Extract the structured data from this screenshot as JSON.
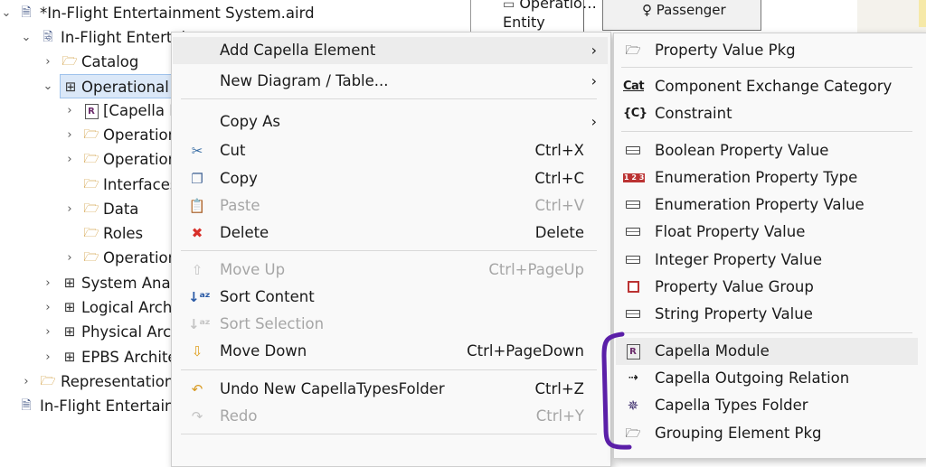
{
  "tree": {
    "items": [
      {
        "label": "*In-Flight Entertainment System.aird",
        "icon": "aird-file-icon",
        "expanded": true
      },
      {
        "label": "In-Flight Entertai",
        "icon": "project-icon",
        "expanded": true
      },
      {
        "label": "Catalog",
        "icon": "folder-icon",
        "expanded": false
      },
      {
        "label": "Operational A",
        "icon": "grid-icon",
        "expanded": true,
        "selected": true
      },
      {
        "label": "[Capella M",
        "icon": "capella-module-icon",
        "expanded": false
      },
      {
        "label": "Operation",
        "icon": "folder-icon",
        "expanded": false
      },
      {
        "label": "Operation",
        "icon": "folder-icon",
        "expanded": false
      },
      {
        "label": "Interfaces",
        "icon": "folder-icon"
      },
      {
        "label": "Data",
        "icon": "folder-icon",
        "expanded": false
      },
      {
        "label": "Roles",
        "icon": "folder-icon"
      },
      {
        "label": "Operation",
        "icon": "folder-icon",
        "expanded": false
      },
      {
        "label": "System Analy",
        "icon": "grid-icon",
        "expanded": false
      },
      {
        "label": "Logical Archi",
        "icon": "grid-icon",
        "expanded": false
      },
      {
        "label": "Physical Arch",
        "icon": "grid-icon",
        "expanded": false
      },
      {
        "label": "EPBS Archite",
        "icon": "grid-icon",
        "expanded": false
      },
      {
        "label": "Representations",
        "icon": "folder-icon",
        "expanded": false
      },
      {
        "label": "In-Flight Entertainm",
        "icon": "document-icon"
      }
    ]
  },
  "diagram": {
    "entity_line1": "Operatio…",
    "entity_line2": "Entity",
    "passenger": "Passenger"
  },
  "context_menu": {
    "add_capella_element": "Add Capella Element",
    "new_diagram_table": "New Diagram / Table...",
    "copy_as": "Copy As",
    "cut": {
      "label": "Cut",
      "shortcut": "Ctrl+X"
    },
    "copy": {
      "label": "Copy",
      "shortcut": "Ctrl+C"
    },
    "paste": {
      "label": "Paste",
      "shortcut": "Ctrl+V"
    },
    "delete": {
      "label": "Delete",
      "shortcut": "Delete"
    },
    "move_up": {
      "label": "Move Up",
      "shortcut": "Ctrl+PageUp"
    },
    "sort_content": {
      "label": "Sort Content"
    },
    "sort_selection": {
      "label": "Sort Selection"
    },
    "move_down": {
      "label": "Move Down",
      "shortcut": "Ctrl+PageDown"
    },
    "undo": {
      "label": "Undo New CapellaTypesFolder",
      "shortcut": "Ctrl+Z"
    },
    "redo": {
      "label": "Redo",
      "shortcut": "Ctrl+Y"
    }
  },
  "submenu": {
    "items": [
      {
        "label": "Property Value Pkg",
        "icon": "folder-icon"
      },
      {
        "label": "Component Exchange Category",
        "icon": "category-icon"
      },
      {
        "label": "Constraint",
        "icon": "constraint-icon"
      },
      {
        "label": "Boolean Property Value",
        "icon": "property-value-icon"
      },
      {
        "label": "Enumeration Property Type",
        "icon": "enumeration-icon"
      },
      {
        "label": "Enumeration Property Value",
        "icon": "property-value-icon"
      },
      {
        "label": "Float Property Value",
        "icon": "property-value-icon"
      },
      {
        "label": "Integer Property Value",
        "icon": "property-value-icon"
      },
      {
        "label": "Property Value Group",
        "icon": "property-group-icon"
      },
      {
        "label": "String Property Value",
        "icon": "property-value-icon"
      },
      {
        "label": "Capella Module",
        "icon": "capella-module-icon"
      },
      {
        "label": "Capella Outgoing Relation",
        "icon": "relation-icon"
      },
      {
        "label": "Capella Types Folder",
        "icon": "types-folder-icon"
      },
      {
        "label": "Grouping Element Pkg",
        "icon": "folder-icon"
      }
    ]
  },
  "annotation_color": "#5b1fa8"
}
